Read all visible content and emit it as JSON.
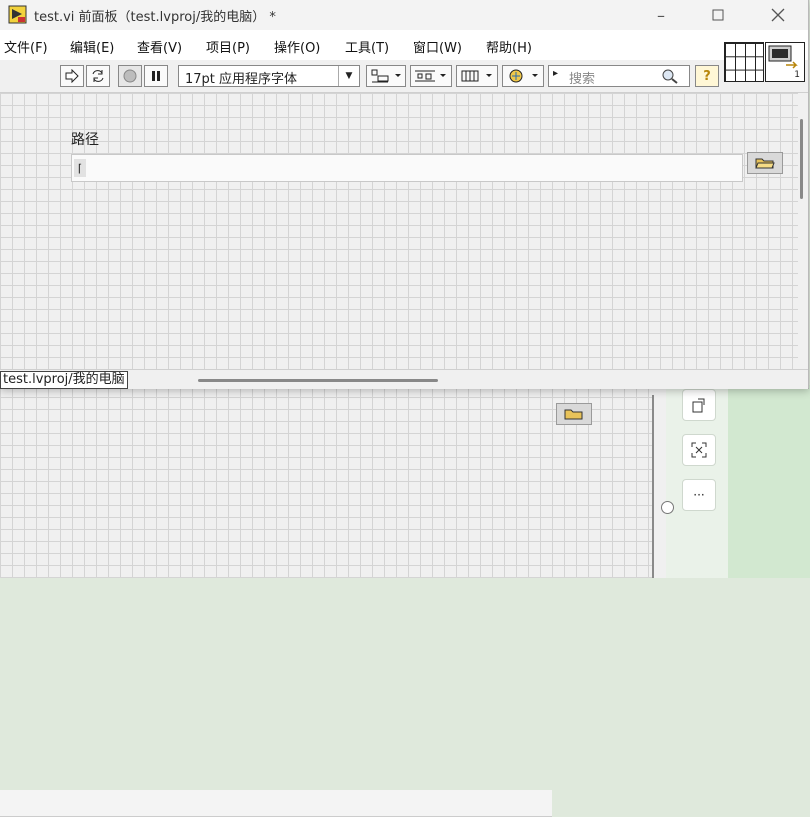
{
  "window": {
    "title": "test.vi 前面板（test.lvproj/我的电脑） *"
  },
  "menu": [
    "文件(F)",
    "编辑(E)",
    "查看(V)",
    "项目(P)",
    "操作(O)",
    "工具(T)",
    "窗口(W)",
    "帮助(H)"
  ],
  "toolbar": {
    "font": "17pt 应用程序字体",
    "search_placeholder": "搜索",
    "help": "?"
  },
  "front_panel": {
    "path_label": "路径",
    "path_value": ""
  },
  "status": {
    "context": "test.lvproj/我的电脑",
    "connector_number": "1"
  },
  "side_panel": {
    "more_label": "···"
  },
  "colors": {
    "panel_grid": "#f0f0f0",
    "side_panel_green": "#d2e8d0",
    "help_accent": "#b8860b"
  }
}
